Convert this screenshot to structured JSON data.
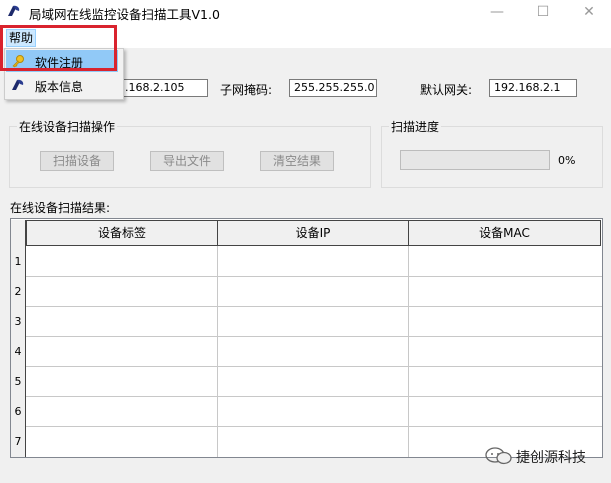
{
  "window": {
    "title": "局域网在线监控设备扫描工具V1.0",
    "controls": {
      "minimize": "—",
      "maximize": "☐",
      "close": "✕"
    }
  },
  "menu": {
    "help": "帮助",
    "items": [
      {
        "label": "软件注册",
        "icon": "key-icon",
        "highlighted": true
      },
      {
        "label": "版本信息",
        "icon": "app-icon",
        "highlighted": false
      }
    ]
  },
  "network": {
    "ip_value": ".168.2.105",
    "subnet_label": "子网掩码:",
    "subnet_value": "255.255.255.0",
    "gateway_label": "默认网关:",
    "gateway_value": "192.168.2.1"
  },
  "scan_group": {
    "title": "在线设备扫描操作",
    "scan_button": "扫描设备",
    "export_button": "导出文件",
    "clear_button": "清空结果"
  },
  "progress_group": {
    "title": "扫描进度",
    "value": 0,
    "text": "0%"
  },
  "results": {
    "label": "在线设备扫描结果:",
    "columns": [
      "设备标签",
      "设备IP",
      "设备MAC"
    ],
    "row_numbers": [
      "1",
      "2",
      "3",
      "4",
      "5",
      "6",
      "7"
    ]
  },
  "watermark": {
    "text": "捷创源科技"
  },
  "colors": {
    "highlight_frame": "#d9232e",
    "menu_selection": "#91c9f7",
    "progress_fill": "#06b025"
  }
}
